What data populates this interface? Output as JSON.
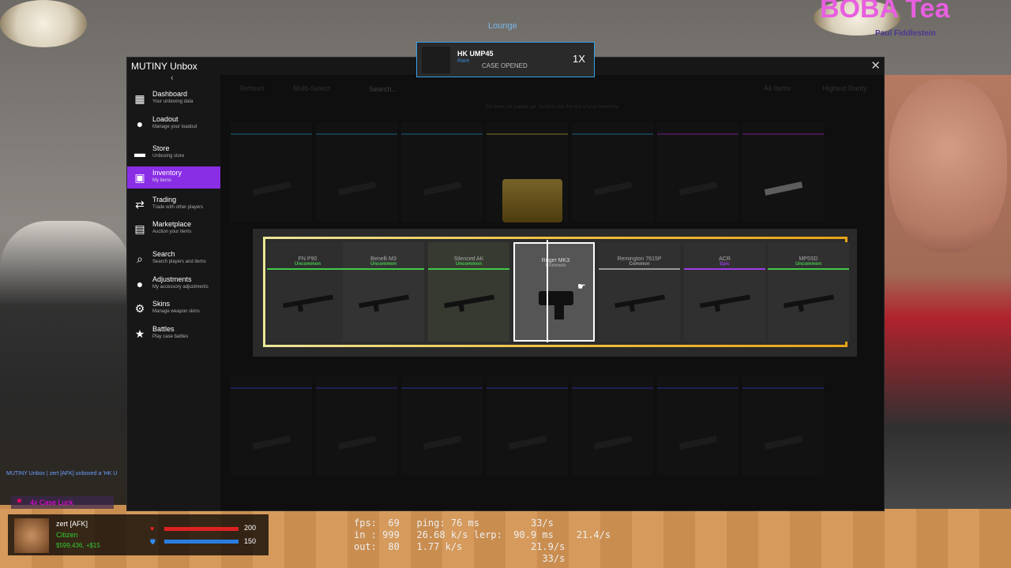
{
  "world": {
    "lounge_label": "Lounge",
    "player_tag": "Paul Fiddlestein",
    "boba_sign": "BOBA Tea",
    "chat_line": "MUTINY Unbox | zert [AFK] unboxed a 'HK U"
  },
  "window": {
    "title": "MUTINY Unbox",
    "close": "✕",
    "back": "‹"
  },
  "sidebar": [
    {
      "label": "Dashboard",
      "sub": "Your unboxing data",
      "icon": "▦"
    },
    {
      "label": "Loadout",
      "sub": "Manage your loadout",
      "icon": "●"
    },
    {
      "label": "Store",
      "sub": "Unboxing store",
      "icon": "▬"
    },
    {
      "label": "Inventory",
      "sub": "My items",
      "icon": "▣"
    },
    {
      "label": "Trading",
      "sub": "Trade with other players",
      "icon": "⇄"
    },
    {
      "label": "Marketplace",
      "sub": "Auction your items",
      "icon": "▤"
    },
    {
      "label": "Search",
      "sub": "Search players and items",
      "icon": "⌕"
    },
    {
      "label": "Adjustments",
      "sub": "My accessory adjustments",
      "icon": "●"
    },
    {
      "label": "Skins",
      "sub": "Manage weapon skins",
      "icon": "⚙"
    },
    {
      "label": "Battles",
      "sub": "Play case battles",
      "icon": "★"
    }
  ],
  "toolbar": {
    "refresh": "Refresh",
    "multi_select": "Multi-Select",
    "search_placeholder": "Search...",
    "filter": "All Items",
    "sort": "Highest Rarity"
  },
  "notice": "3/4 items not loaded yet. Scroll to see the rest of your inventory.",
  "roller": [
    {
      "name": "FN P90",
      "rarity": "Uncommon",
      "color": "#43c94a"
    },
    {
      "name": "Benelli M3",
      "rarity": "Uncommon",
      "color": "#43c94a"
    },
    {
      "name": "Silenced AK",
      "rarity": "Uncommon",
      "color": "#43c94a"
    },
    {
      "name": "Ruger MK3",
      "rarity": "Common",
      "color": "#b0b0b0"
    },
    {
      "name": "Remington 7615P",
      "rarity": "Common",
      "color": "#b0b0b0"
    },
    {
      "name": "ACR",
      "rarity": "Epic",
      "color": "#a23ce8"
    },
    {
      "name": "MP5SD",
      "rarity": "Uncommon",
      "color": "#43c94a"
    }
  ],
  "notification": {
    "item": "HK UMP45",
    "rarity": "Rare",
    "status": "CASE OPENED",
    "multiplier": "1X"
  },
  "hud": {
    "luck": "4x Case Luck",
    "player_name": "zert [AFK]",
    "job": "Citizen",
    "money": "$599,436, +$15",
    "hp": "200",
    "armor": "150",
    "hp_fraction": 1.0,
    "armor_fraction": 1.0
  },
  "netgraph": "fps:  69   ping: 76 ms         33/s\nin : 999   26.68 k/s lerp:  90.9 ms    21.4/s\nout:  80   1.77 k/s            21.9/s\n                                 33/s"
}
